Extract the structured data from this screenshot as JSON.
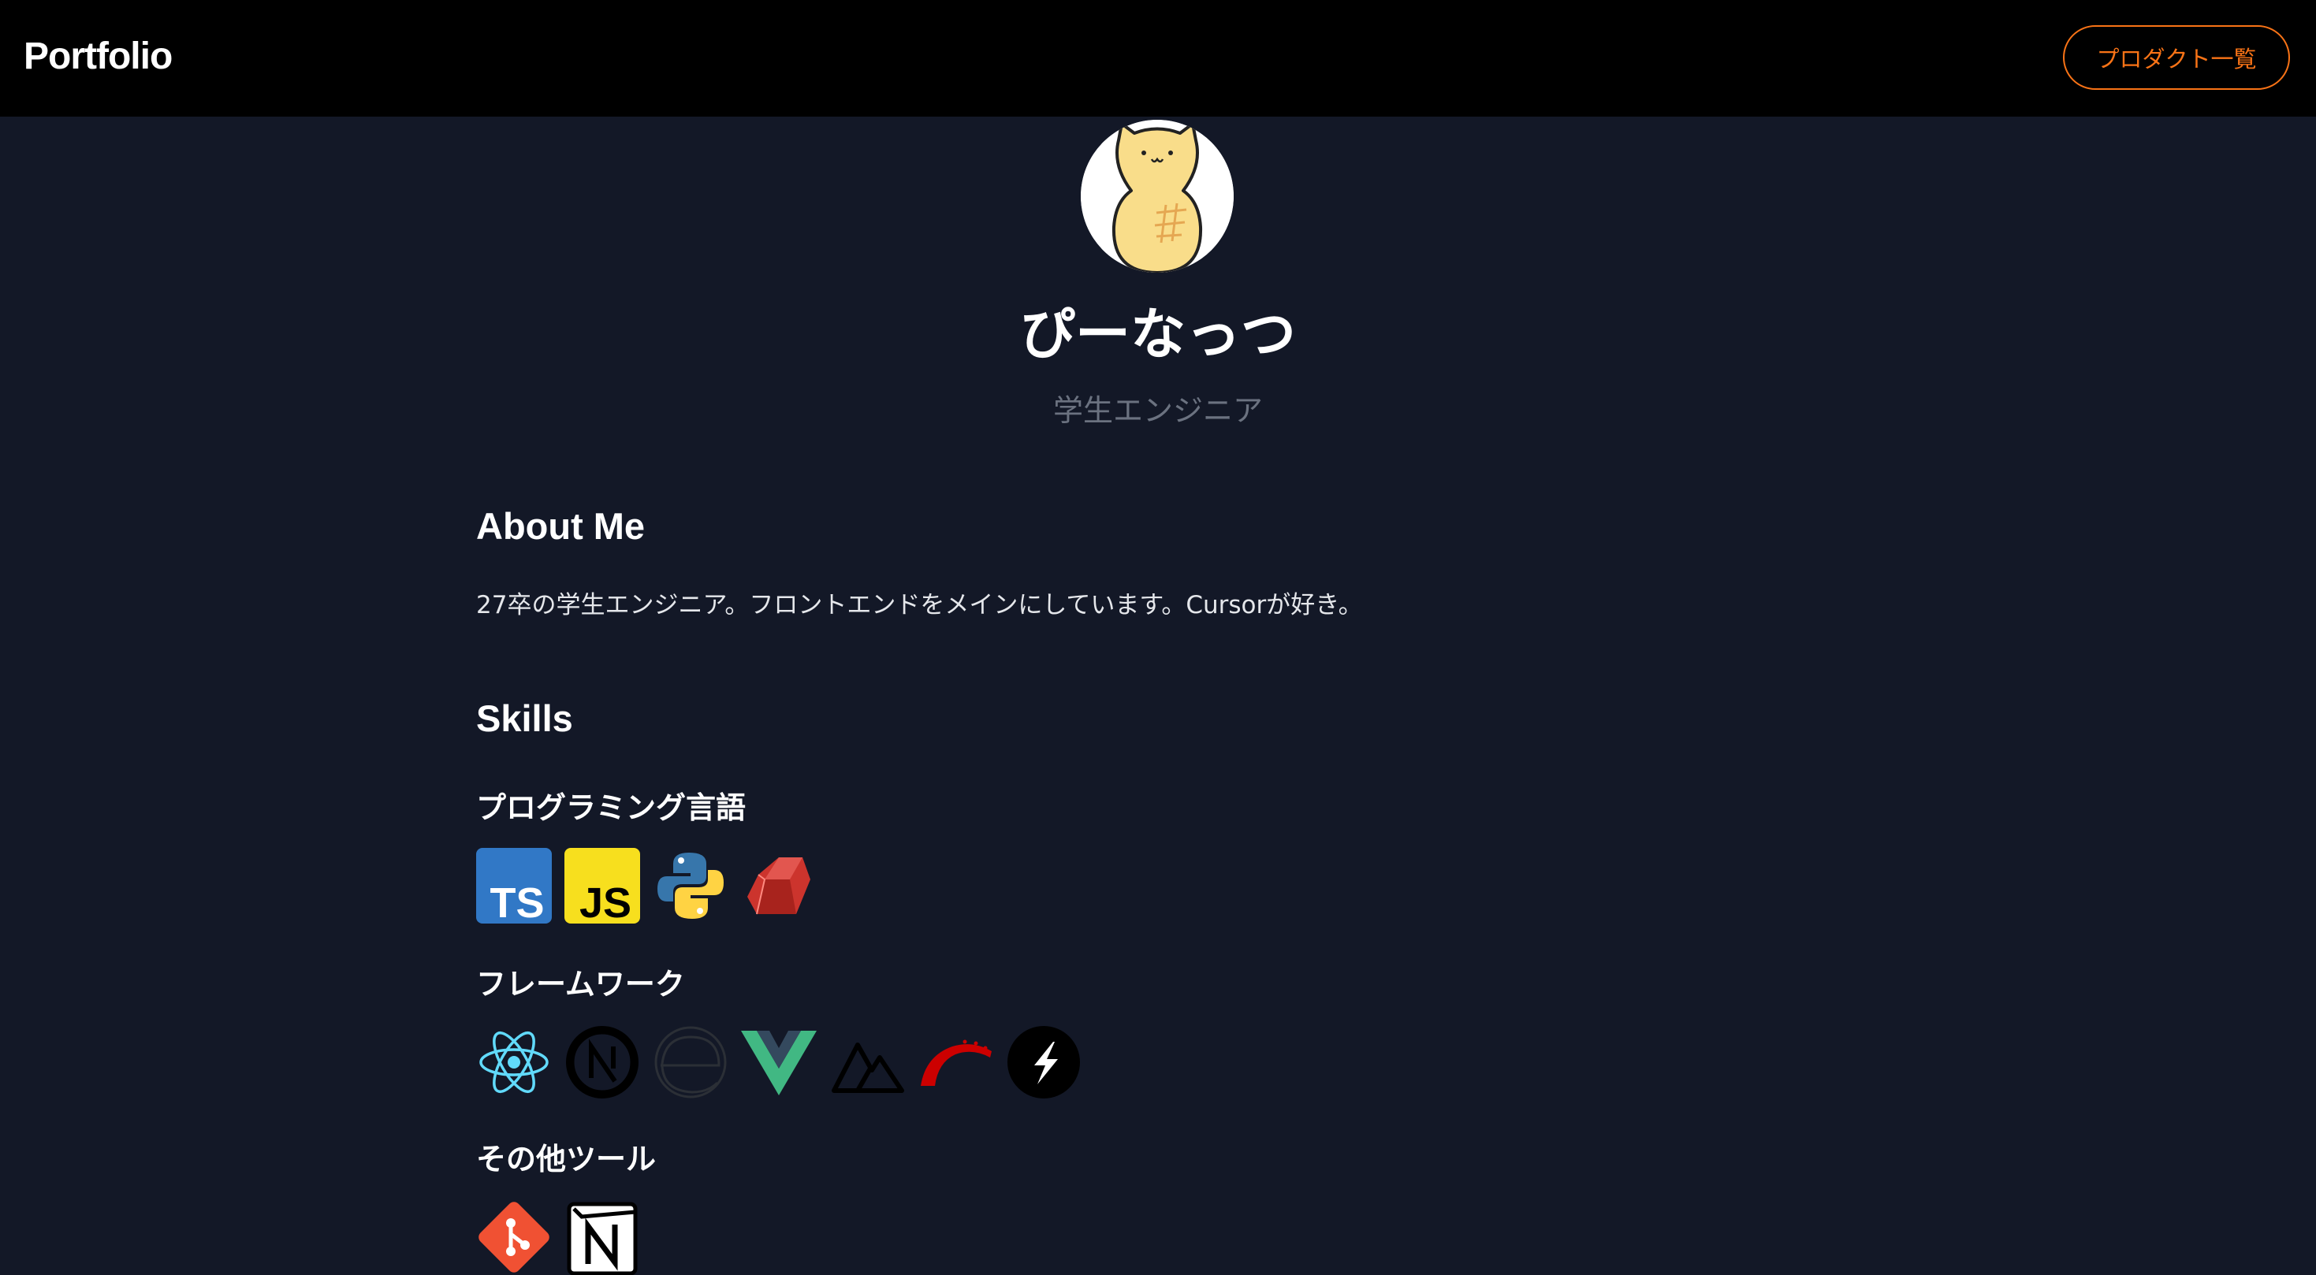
{
  "header": {
    "brand": "Portfolio",
    "nav_button_label": "プロダクト一覧"
  },
  "profile": {
    "avatar_icon": "peanut-cat-icon",
    "name": "ぴーなっつ",
    "role": "学生エンジニア"
  },
  "about": {
    "heading": "About Me",
    "text": "27卒の学生エンジニア。フロントエンドをメインにしています。Cursorが好き。"
  },
  "skills": {
    "heading": "Skills",
    "categories": [
      {
        "title": "プログラミング言語",
        "icons": [
          "typescript-icon",
          "javascript-icon",
          "python-icon",
          "ruby-icon"
        ]
      },
      {
        "title": "フレームワーク",
        "icons": [
          "react-icon",
          "nextjs-icon",
          "electron-icon",
          "vue-icon",
          "nuxt-icon",
          "rails-icon",
          "hono-icon"
        ]
      },
      {
        "title": "その他ツール",
        "icons": [
          "git-icon",
          "notion-icon"
        ]
      }
    ]
  },
  "colors": {
    "background": "#131827",
    "header": "#000000",
    "accent": "#f97316",
    "muted": "#6b7280"
  }
}
